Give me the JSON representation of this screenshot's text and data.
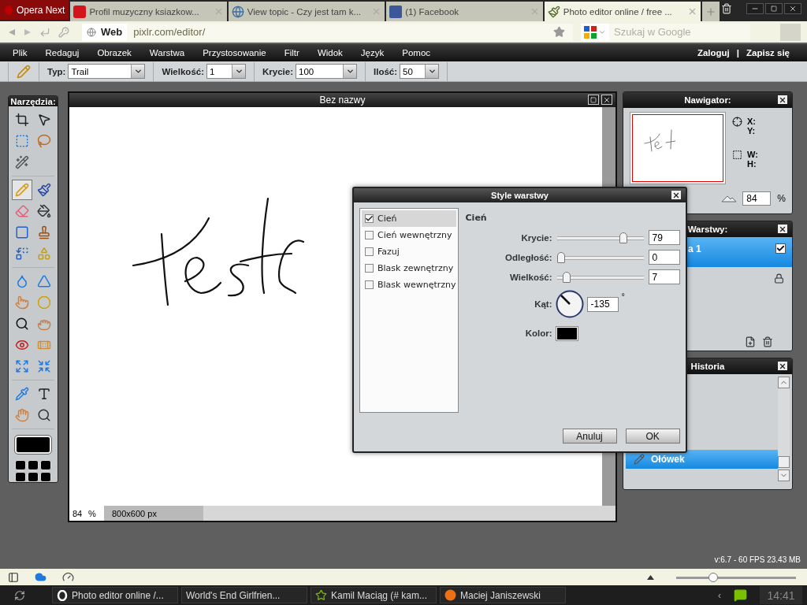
{
  "browser": {
    "opera_button": "Opera Next",
    "tabs": [
      {
        "title": "Profil muzyczny ksiazkow...",
        "kind": "redlogo",
        "selected": false
      },
      {
        "title": "View topic - Czy jest tam k...",
        "kind": "globe",
        "selected": false
      },
      {
        "title": "(1) Facebook",
        "kind": "bluelogo",
        "selected": false
      },
      {
        "title": "Photo editor online / free ...",
        "kind": "brush",
        "selected": true
      }
    ],
    "address": {
      "badge": "Web",
      "url": "pixlr.com/editor/"
    },
    "search": {
      "placeholder": "Szukaj w Google"
    }
  },
  "menu": {
    "items": [
      "Plik",
      "Redaguj",
      "Obrazek",
      "Warstwa",
      "Przystosowanie",
      "Filtr",
      "Widok",
      "Język",
      "Pomoc"
    ],
    "login": "Zaloguj",
    "separator": "|",
    "signup": "Zapisz się"
  },
  "options": [
    {
      "label": "Typ:",
      "value": "Trail"
    },
    {
      "label": "Wielkość:",
      "value": "1"
    },
    {
      "label": "Krycie:",
      "value": "100"
    },
    {
      "label": "Ilość:",
      "value": "50"
    }
  ],
  "tools": {
    "title": "Narzędzia:",
    "groups": [
      [
        {
          "kind": "crop",
          "selected": false
        },
        {
          "kind": "move",
          "selected": false
        },
        {
          "kind": "marquee",
          "selected": false
        },
        {
          "kind": "lasso",
          "selected": false
        },
        {
          "kind": "wand",
          "selected": false
        }
      ],
      [
        {
          "kind": "pencil",
          "selected": true
        },
        {
          "kind": "brush",
          "selected": false
        },
        {
          "kind": "eraser",
          "selected": false
        },
        {
          "kind": "bucket",
          "selected": false
        },
        {
          "kind": "gradient",
          "selected": false
        },
        {
          "kind": "stamp",
          "selected": false
        },
        {
          "kind": "replace",
          "selected": false
        },
        {
          "kind": "shape",
          "selected": false
        }
      ],
      [
        {
          "kind": "blur",
          "selected": false
        },
        {
          "kind": "sharpen",
          "selected": false
        },
        {
          "kind": "smudge",
          "selected": false
        },
        {
          "kind": "sponge",
          "selected": false
        },
        {
          "kind": "burn",
          "selected": false
        },
        {
          "kind": "dodge",
          "selected": false
        },
        {
          "kind": "redeye",
          "selected": false
        },
        {
          "kind": "heal",
          "selected": false
        },
        {
          "kind": "bloat",
          "selected": false
        },
        {
          "kind": "pinch",
          "selected": false
        }
      ],
      [
        {
          "kind": "picker",
          "selected": false
        },
        {
          "kind": "text",
          "selected": false
        },
        {
          "kind": "hand",
          "selected": false
        },
        {
          "kind": "zoom",
          "selected": false
        }
      ]
    ],
    "color": "#000000"
  },
  "document": {
    "title": "Bez nazwy",
    "zoom": "84",
    "zoom_unit": "%",
    "size": "800x600 px"
  },
  "navigator": {
    "title": "Nawigator:",
    "x": "X:",
    "y": "Y:",
    "w": "W:",
    "h": "H:",
    "zoom": "84",
    "zoom_unit": "%"
  },
  "layers": {
    "title": "Warstwy:",
    "items": [
      {
        "name": "a 1",
        "selected": true,
        "visible": true
      }
    ]
  },
  "history": {
    "title": "Historia",
    "items": [
      {
        "label": "Ołówek",
        "selected": true
      }
    ]
  },
  "dialog": {
    "title": "Style warstwy",
    "styles": [
      {
        "label": "Cień",
        "checked": true,
        "selected": true
      },
      {
        "label": "Cień wewnętrzny",
        "checked": false,
        "selected": false
      },
      {
        "label": "Fazuj",
        "checked": false,
        "selected": false
      },
      {
        "label": "Blask zewnętrzny",
        "checked": false,
        "selected": false
      },
      {
        "label": "Blask wewnętrzny",
        "checked": false,
        "selected": false
      }
    ],
    "heading": "Cień",
    "sliders": [
      {
        "label": "Krycie:",
        "value": "79",
        "level": 0.79
      },
      {
        "label": "Odległość:",
        "value": "0",
        "level": 0
      },
      {
        "label": "Wielkość:",
        "value": "7",
        "level": 0.07
      }
    ],
    "angle": {
      "label": "Kąt:",
      "value": "-135",
      "unit": "°"
    },
    "color": {
      "label": "Kolor:",
      "color": "#000000"
    },
    "buttons": [
      "Anuluj",
      "OK"
    ]
  },
  "version": "v:6.7 - 60 FPS 23.43 MB",
  "status_bar": {
    "zoom_slider": {
      "level": 0.29
    }
  },
  "taskbar": {
    "tasks": [
      {
        "title": "Photo editor online /...",
        "kind": "opera"
      },
      {
        "title": "World's End Girlfrien...",
        "kind": "none"
      },
      {
        "title": "Kamil Maciąg (# kam...",
        "kind": "star"
      },
      {
        "title": "Maciej Janiszewski",
        "kind": "badge"
      }
    ],
    "arrow": "‹",
    "clock": "14:41"
  }
}
